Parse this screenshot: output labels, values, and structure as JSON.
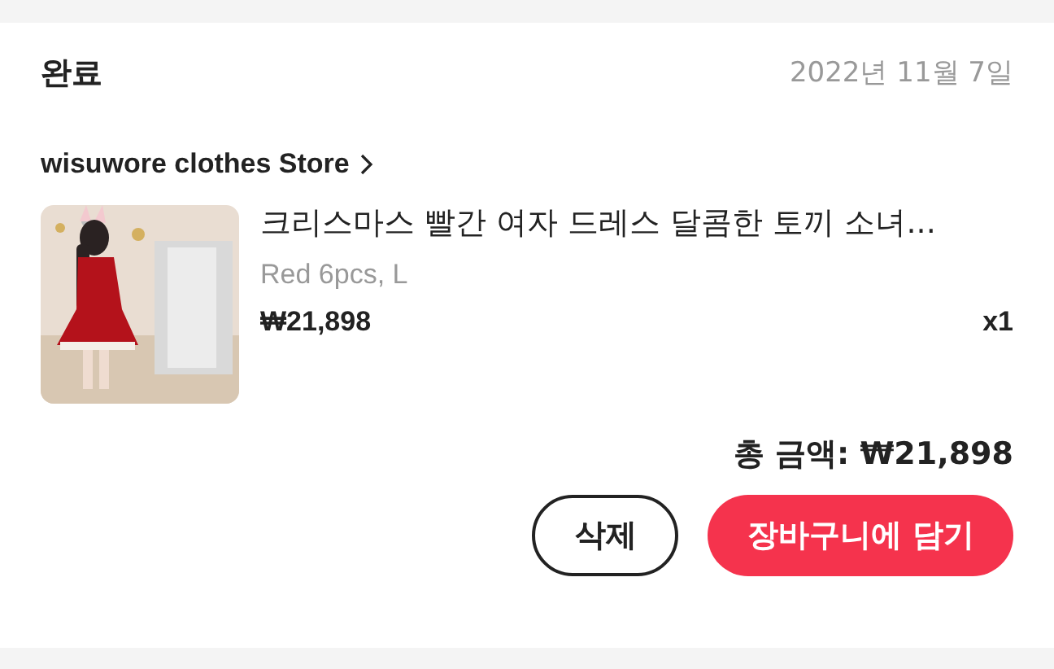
{
  "order": {
    "status": "완료",
    "date": "2022년 11월 7일",
    "store": "wisuwore clothes Store",
    "product": {
      "title": "크리스마스 빨간 여자 드레스 달콤한 토끼 소녀...",
      "variant": "Red 6pcs, L",
      "price": "₩21,898",
      "quantity": "x1"
    },
    "total": "총 금액: ₩21,898",
    "buttons": [
      {
        "label": "삭제",
        "kind": "outline"
      },
      {
        "label": "장바구니에 담기",
        "kind": "primary"
      }
    ]
  }
}
